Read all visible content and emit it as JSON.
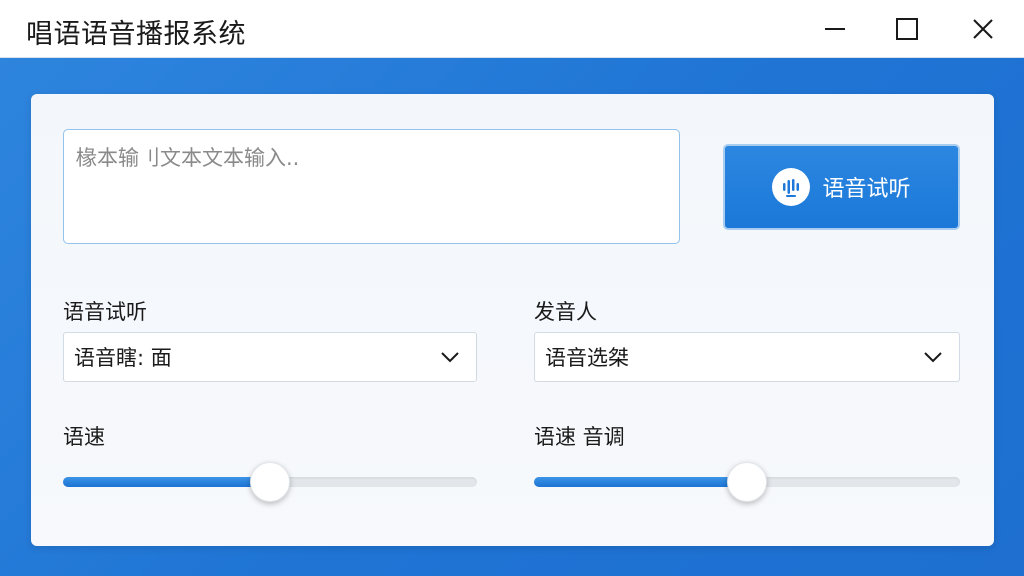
{
  "window": {
    "title": "唱语语音播报系统"
  },
  "input": {
    "placeholder": "椽本输刂文本文本输入.."
  },
  "play_button": {
    "label": "语音试听",
    "icon": "sound-wave-icon"
  },
  "left_group": {
    "label": "语音试听",
    "select_value": "语音瞎: 面"
  },
  "right_group": {
    "label": "发音人",
    "select_value": "语音选桀"
  },
  "speed": {
    "label": "语速",
    "value_percent": 50
  },
  "pitch": {
    "label": "语速 音调",
    "value_percent": 50
  },
  "colors": {
    "accent": "#1f78d8",
    "background": "#2f86de",
    "panel": "#f5f8fb"
  }
}
